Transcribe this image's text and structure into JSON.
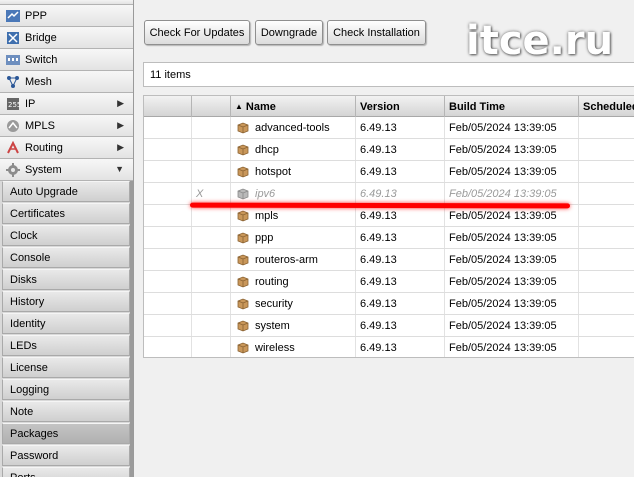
{
  "sidebar": {
    "items": [
      {
        "label": "PPP",
        "icon": "ppp-icon"
      },
      {
        "label": "Bridge",
        "icon": "bridge-icon"
      },
      {
        "label": "Switch",
        "icon": "switch-icon"
      },
      {
        "label": "Mesh",
        "icon": "mesh-icon"
      },
      {
        "label": "IP",
        "icon": "ip-icon",
        "arrow": "▶"
      },
      {
        "label": "MPLS",
        "icon": "mpls-icon",
        "arrow": "▶"
      },
      {
        "label": "Routing",
        "icon": "routing-icon",
        "arrow": "▶"
      },
      {
        "label": "System",
        "icon": "system-gear-icon",
        "arrow": "▼"
      }
    ],
    "system_submenu": [
      "Auto Upgrade",
      "Certificates",
      "Clock",
      "Console",
      "Disks",
      "History",
      "Identity",
      "LEDs",
      "License",
      "Logging",
      "Note",
      "Packages",
      "Password",
      "Ports"
    ],
    "selected_submenu": "Packages"
  },
  "toolbar": {
    "check_updates": "Check For Updates",
    "downgrade": "Downgrade",
    "check_installation": "Check Installation"
  },
  "watermark": "itce.ru",
  "items_count": "11 items",
  "table": {
    "sort_arrow": "▲",
    "columns": [
      "Name",
      "Version",
      "Build Time",
      "Scheduled"
    ],
    "rows": [
      {
        "flag": "",
        "name": "advanced-tools",
        "version": "6.49.13",
        "build_time": "Feb/05/2024 13:39:05",
        "disabled": false
      },
      {
        "flag": "",
        "name": "dhcp",
        "version": "6.49.13",
        "build_time": "Feb/05/2024 13:39:05",
        "disabled": false
      },
      {
        "flag": "",
        "name": "hotspot",
        "version": "6.49.13",
        "build_time": "Feb/05/2024 13:39:05",
        "disabled": false
      },
      {
        "flag": "X",
        "name": "ipv6",
        "version": "6.49.13",
        "build_time": "Feb/05/2024 13:39:05",
        "disabled": true
      },
      {
        "flag": "",
        "name": "mpls",
        "version": "6.49.13",
        "build_time": "Feb/05/2024 13:39:05",
        "disabled": false
      },
      {
        "flag": "",
        "name": "ppp",
        "version": "6.49.13",
        "build_time": "Feb/05/2024 13:39:05",
        "disabled": false
      },
      {
        "flag": "",
        "name": "routeros-arm",
        "version": "6.49.13",
        "build_time": "Feb/05/2024 13:39:05",
        "disabled": false
      },
      {
        "flag": "",
        "name": "routing",
        "version": "6.49.13",
        "build_time": "Feb/05/2024 13:39:05",
        "disabled": false
      },
      {
        "flag": "",
        "name": "security",
        "version": "6.49.13",
        "build_time": "Feb/05/2024 13:39:05",
        "disabled": false
      },
      {
        "flag": "",
        "name": "system",
        "version": "6.49.13",
        "build_time": "Feb/05/2024 13:39:05",
        "disabled": false
      },
      {
        "flag": "",
        "name": "wireless",
        "version": "6.49.13",
        "build_time": "Feb/05/2024 13:39:05",
        "disabled": false
      }
    ]
  },
  "colors": {
    "strike_line": "#ff0000",
    "selected_submenu_bg": "#b8b8b8"
  }
}
